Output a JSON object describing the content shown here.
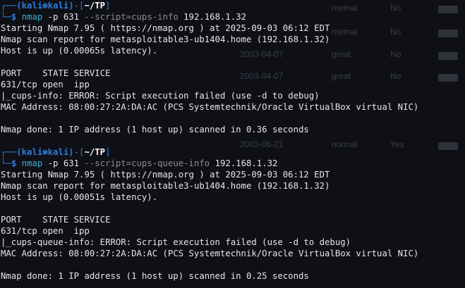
{
  "session1": {
    "prompt_user": "(kali⊛kali)",
    "prompt_path": "~/TP",
    "command": "nmap",
    "args_p": "-p 631",
    "args_script": "--script=cups-info",
    "args_target": "192.168.1.32",
    "output": [
      "Starting Nmap 7.95 ( https://nmap.org ) at 2025-09-03 06:12 EDT",
      "Nmap scan report for metasploitable3-ub1404.home (192.168.1.32)",
      "Host is up (0.00065s latency).",
      "",
      "PORT    STATE SERVICE",
      "631/tcp open  ipp",
      "|_cups-info: ERROR: Script execution failed (use -d to debug)",
      "MAC Address: 08:00:27:2A:DA:AC (PCS Systemtechnik/Oracle VirtualBox virtual NIC)",
      "",
      "Nmap done: 1 IP address (1 host up) scanned in 0.36 seconds"
    ]
  },
  "session2": {
    "prompt_user": "(kali⊛kali)",
    "prompt_path": "~/TP",
    "command": "nmap",
    "args_p": "-p 631",
    "args_script": "--script=cups-queue-info",
    "args_target": "192.168.1.32",
    "output": [
      "Starting Nmap 7.95 ( https://nmap.org ) at 2025-09-03 06:12 EDT",
      "Nmap scan report for metasploitable3-ub1404.home (192.168.1.32)",
      "Host is up (0.00051s latency).",
      "",
      "PORT    STATE SERVICE",
      "631/tcp open  ipp",
      "|_cups-queue-info: ERROR: Script execution failed (use -d to debug)",
      "MAC Address: 08:00:27:2A:DA:AC (PCS Systemtechnik/Oracle VirtualBox virtual NIC)",
      "",
      "Nmap done: 1 IP address (1 host up) scanned in 0.25 seconds"
    ]
  },
  "background_ghost": {
    "items": [
      "normal",
      "No",
      "normal",
      "No",
      "2003-04-07",
      "great",
      "No",
      "2003-04-07",
      "great",
      "No",
      "2003-06-21",
      "normal",
      "Yes"
    ]
  },
  "colors": {
    "background": "#0e1016",
    "prompt_blue": "#2f7bd8",
    "command_cyan": "#3fb0d6",
    "text": "#e6e6e6"
  }
}
